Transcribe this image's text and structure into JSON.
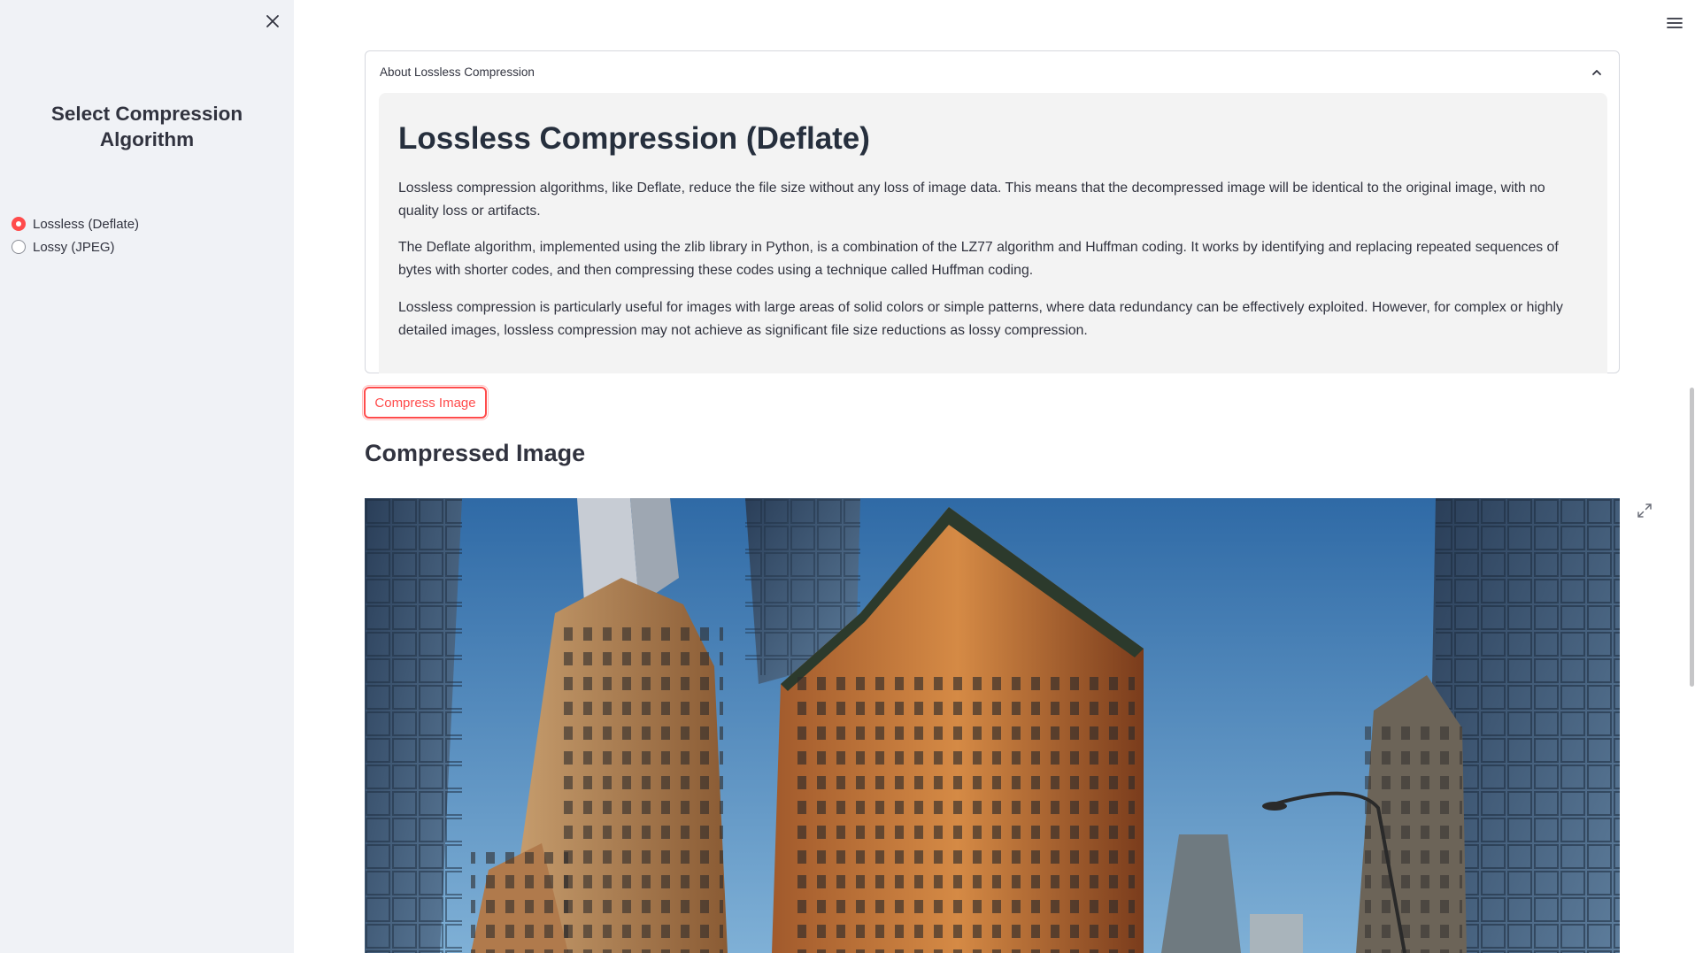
{
  "sidebar": {
    "title": "Select Compression Algorithm",
    "options": [
      {
        "label": "Lossless (Deflate)",
        "selected": true
      },
      {
        "label": "Lossy (JPEG)",
        "selected": false
      }
    ]
  },
  "expander": {
    "label": "About Lossless Compression",
    "heading": "Lossless Compression (Deflate)",
    "paragraphs": [
      "Lossless compression algorithms, like Deflate, reduce the file size without any loss of image data. This means that the decompressed image will be identical to the original image, with no quality loss or artifacts.",
      "The Deflate algorithm, implemented using the zlib library in Python, is a combination of the LZ77 algorithm and Huffman coding. It works by identifying and replacing repeated sequences of bytes with shorter codes, and then compressing these codes using a technique called Huffman coding.",
      "Lossless compression is particularly useful for images with large areas of solid colors or simple patterns, where data redundancy can be effectively exploited. However, for complex or highly detailed images, lossless compression may not achieve as significant file size reductions as lossy compression."
    ]
  },
  "main": {
    "compress_button": "Compress Image",
    "result_heading": "Compressed Image"
  },
  "colors": {
    "accent": "#ff4b4b",
    "sidebar_bg": "#f0f2f6"
  },
  "icons": {
    "close": "close-icon",
    "menu": "hamburger-menu-icon",
    "chevron": "chevron-up-icon",
    "fullscreen": "fullscreen-icon"
  }
}
